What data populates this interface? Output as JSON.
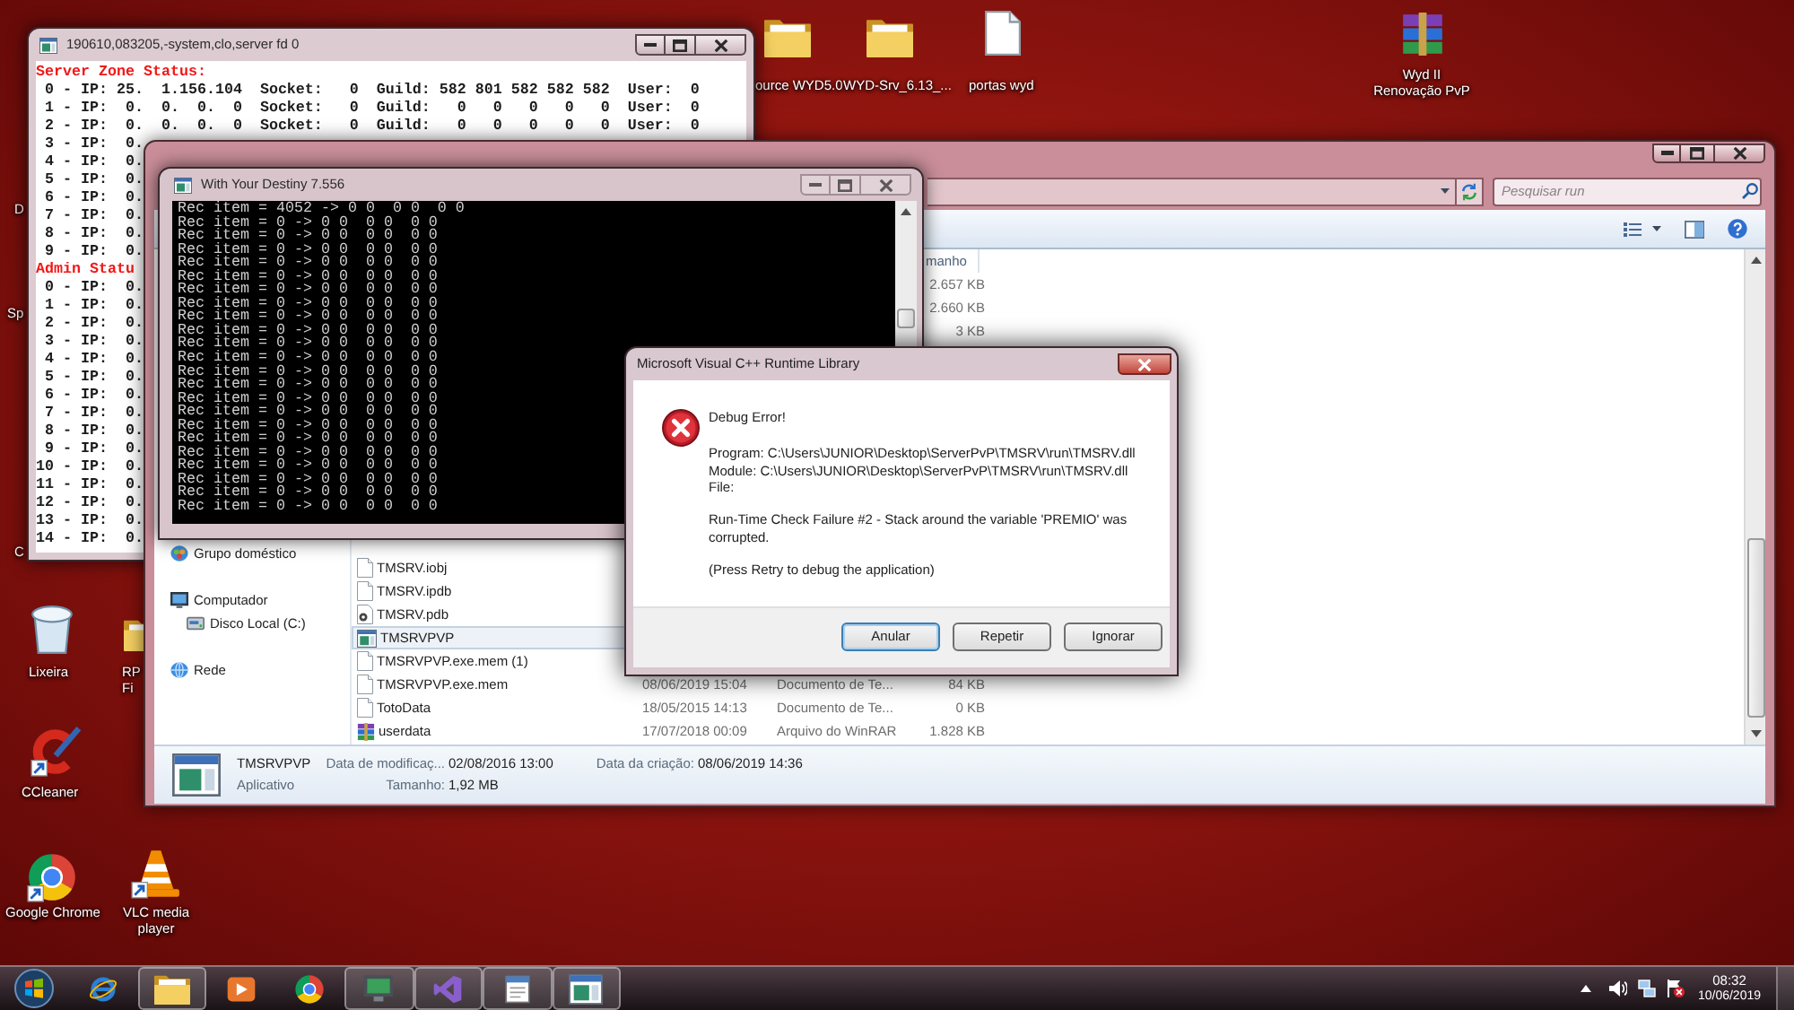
{
  "desktop": {
    "icons": [
      {
        "label": "ource WYD5.0",
        "kind": "folder"
      },
      {
        "label": "WYD-Srv_6.13_...",
        "kind": "folder"
      },
      {
        "label": "portas wyd",
        "kind": "file"
      },
      {
        "label": "Wyd II Renovação PvP",
        "kind": "archive"
      },
      {
        "label": "Lixeira",
        "kind": "bin"
      },
      {
        "label": "RP Fi",
        "kind": "folder"
      },
      {
        "label": "CCleaner",
        "kind": "cleaner"
      },
      {
        "label": "Google Chrome",
        "kind": "browser"
      },
      {
        "label": "VLC media player",
        "kind": "player"
      },
      {
        "label": "D",
        "kind": "cut"
      },
      {
        "label": "Sp",
        "kind": "cut"
      },
      {
        "label": "C",
        "kind": "cut"
      }
    ]
  },
  "server_window": {
    "title": "190610,083205,-system,clo,server fd 0",
    "sections": [
      {
        "heading": "Server Zone Status:",
        "lines": [
          " 0 - IP: 25.  1.156.104  Socket:   0  Guild: 582 801 582 582 582  User:  0",
          " 1 - IP:  0.  0.  0.  0  Socket:   0  Guild:   0   0   0   0   0  User:  0",
          " 2 - IP:  0.  0.  0.  0  Socket:   0  Guild:   0   0   0   0   0  User:  0",
          " 3 - IP:  0.",
          " 4 - IP:  0.",
          " 5 - IP:  0.",
          " 6 - IP:  0.",
          " 7 - IP:  0.",
          " 8 - IP:  0.",
          " 9 - IP:  0."
        ]
      },
      {
        "heading": "Admin Statu",
        "lines": [
          " 0 - IP:  0.",
          " 1 - IP:  0.",
          " 2 - IP:  0.",
          " 3 - IP:  0.",
          " 4 - IP:  0.",
          " 5 - IP:  0.",
          " 6 - IP:  0.",
          " 7 - IP:  0.",
          " 8 - IP:  0.",
          " 9 - IP:  0.",
          "10 - IP:  0.",
          "11 - IP:  0.",
          "12 - IP:  0.",
          "13 - IP:  0.",
          "14 - IP:  0."
        ]
      }
    ]
  },
  "explorer": {
    "search": {
      "placeholder": "Pesquisar run"
    },
    "nav": [
      {
        "label": "Grupo doméstico",
        "kind": "homegroup"
      },
      {
        "label": "Computador",
        "kind": "computer",
        "children": [
          {
            "label": "Disco Local (C:)",
            "kind": "drive"
          }
        ]
      },
      {
        "label": "Rede",
        "kind": "network"
      }
    ],
    "column_header": "manho",
    "upper_rows": [
      {
        "size": "2.657 KB"
      },
      {
        "size": "2.660 KB"
      },
      {
        "size": "3 KB"
      }
    ],
    "rows": [
      {
        "name": "TMSRV.iobj",
        "kind": "file",
        "selected": false
      },
      {
        "name": "TMSRV.ipdb",
        "kind": "file",
        "selected": false
      },
      {
        "name": "TMSRV.pdb",
        "kind": "symbols",
        "selected": false
      },
      {
        "name": "TMSRVPVP",
        "kind": "application",
        "selected": true
      },
      {
        "name": "TMSRVPVP.exe.mem (1)",
        "kind": "file",
        "selected": false
      },
      {
        "name": "TMSRVPVP.exe.mem",
        "kind": "file",
        "selected": false,
        "date": "08/06/2019 15:04",
        "type": "Documento de Te...",
        "size": "84 KB"
      },
      {
        "name": "TotoData",
        "kind": "file",
        "selected": false,
        "date": "18/05/2015 14:13",
        "type": "Documento de Te...",
        "size": "0 KB"
      },
      {
        "name": "userdata",
        "kind": "archive",
        "selected": false,
        "date": "17/07/2018 00:09",
        "type": "Arquivo do WinRAR",
        "size": "1.828 KB"
      }
    ],
    "details": {
      "name": "TMSRVPVP",
      "type": "Aplicativo",
      "fields": [
        {
          "label": "Data de modificaç...",
          "value": "02/08/2016 13:00"
        },
        {
          "label": "Tamanho:",
          "value": "1,92 MB"
        },
        {
          "label": "Data da criação:",
          "value": "08/06/2019 14:36"
        }
      ]
    }
  },
  "console_window": {
    "title": "With Your Destiny 7.556",
    "lines": [
      "Rec item = 4052 -> 0 0  0 0  0 0",
      "Rec item = 0 -> 0 0  0 0  0 0",
      "Rec item = 0 -> 0 0  0 0  0 0",
      "Rec item = 0 -> 0 0  0 0  0 0",
      "Rec item = 0 -> 0 0  0 0  0 0",
      "Rec item = 0 -> 0 0  0 0  0 0",
      "Rec item = 0 -> 0 0  0 0  0 0",
      "Rec item = 0 -> 0 0  0 0  0 0",
      "Rec item = 0 -> 0 0  0 0  0 0",
      "Rec item = 0 -> 0 0  0 0  0 0",
      "Rec item = 0 -> 0 0  0 0  0 0",
      "Rec item = 0 -> 0 0  0 0  0 0",
      "Rec item = 0 -> 0 0  0 0  0 0",
      "Rec item = 0 -> 0 0  0 0  0 0",
      "Rec item = 0 -> 0 0  0 0  0 0",
      "Rec item = 0 -> 0 0  0 0  0 0",
      "Rec item = 0 -> 0 0  0 0  0 0",
      "Rec item = 0 -> 0 0  0 0  0 0",
      "Rec item = 0 -> 0 0  0 0  0 0",
      "Rec item = 0 -> 0 0  0 0  0 0",
      "Rec item = 0 -> 0 0  0 0  0 0",
      "Rec item = 0 -> 0 0  0 0  0 0",
      "Rec item = 0 -> 0 0  0 0  0 0"
    ]
  },
  "dialog": {
    "title": "Microsoft Visual C++ Runtime Library",
    "heading": "Debug Error!",
    "details": [
      "Program: C:\\Users\\JUNIOR\\Desktop\\ServerPvP\\TMSRV\\run\\TMSRV.dll",
      "Module: C:\\Users\\JUNIOR\\Desktop\\ServerPvP\\TMSRV\\run\\TMSRV.dll",
      "File:"
    ],
    "message": "Run-Time Check Failure #2 - Stack around the variable 'PREMIO' was corrupted.",
    "hint": "(Press Retry to debug the application)",
    "buttons": [
      {
        "label": "Anular",
        "default": true
      },
      {
        "label": "Repetir",
        "default": false
      },
      {
        "label": "Ignorar",
        "default": false
      }
    ]
  },
  "taskbar": {
    "apps": [
      {
        "kind": "e-logo",
        "open": false
      },
      {
        "kind": "folder",
        "open": true
      },
      {
        "kind": "play",
        "open": false
      },
      {
        "kind": "ring-logo",
        "open": false
      },
      {
        "kind": "monitor",
        "open": true
      },
      {
        "kind": "ribbon",
        "open": true
      },
      {
        "kind": "document",
        "open": true
      },
      {
        "kind": "app-window",
        "open": true
      }
    ],
    "clock": {
      "time": "08:32",
      "date": "10/06/2019"
    }
  }
}
